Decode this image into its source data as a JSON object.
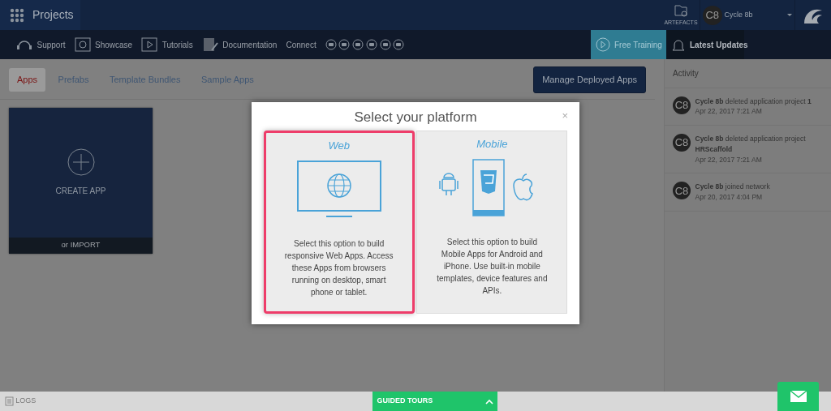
{
  "header": {
    "title": "Projects",
    "artefacts": "ARTEFACTS",
    "user_avatar": "C8",
    "user_name": "Cycle 8b"
  },
  "toolbar": {
    "links": [
      {
        "kind": "support",
        "label": "Support"
      },
      {
        "kind": "showcase",
        "label": "Showcase"
      },
      {
        "kind": "tutorials",
        "label": "Tutorials"
      },
      {
        "kind": "documentation",
        "label": "Documentation"
      }
    ],
    "connect": "Connect",
    "free_training": "Free Training",
    "latest_updates": "Latest Updates"
  },
  "tabs": [
    {
      "label": "Apps",
      "selected": true
    },
    {
      "label": "Prefabs",
      "selected": false
    },
    {
      "label": "Template Bundles",
      "selected": false
    },
    {
      "label": "Sample Apps",
      "selected": false
    }
  ],
  "manage_button": "Manage Deployed Apps",
  "create_card": {
    "label": "CREATE APP",
    "import": "or IMPORT"
  },
  "activity": {
    "title": "Activity",
    "items": [
      {
        "avatar": "C8",
        "text": "**Cycle 8b** deleted application project **1**",
        "time": "Apr 22, 2017 7:21 AM"
      },
      {
        "avatar": "C8",
        "text": "**Cycle 8b** deleted application project **HRScaffold**",
        "time": "Apr 22, 2017 7:21 AM"
      },
      {
        "avatar": "C8",
        "text": "**Cycle 8b** joined network",
        "time": "Apr 20, 2017 4:04 PM"
      }
    ]
  },
  "modal": {
    "title": "Select your platform",
    "close": "×",
    "options": [
      {
        "kind": "web",
        "title": "Web",
        "description": "Select this option to build responsive Web Apps. Access these Apps from browsers running on desktop, smart phone or tablet.",
        "selected": true
      },
      {
        "kind": "mobile",
        "title": "Mobile",
        "description": "Select this option to build Mobile Apps for Android and iPhone. Use built-in mobile templates, device features and APIs.",
        "selected": false
      }
    ]
  },
  "footer": {
    "logs": "LOGS",
    "guided_tours": "GUIDED TOURS"
  }
}
